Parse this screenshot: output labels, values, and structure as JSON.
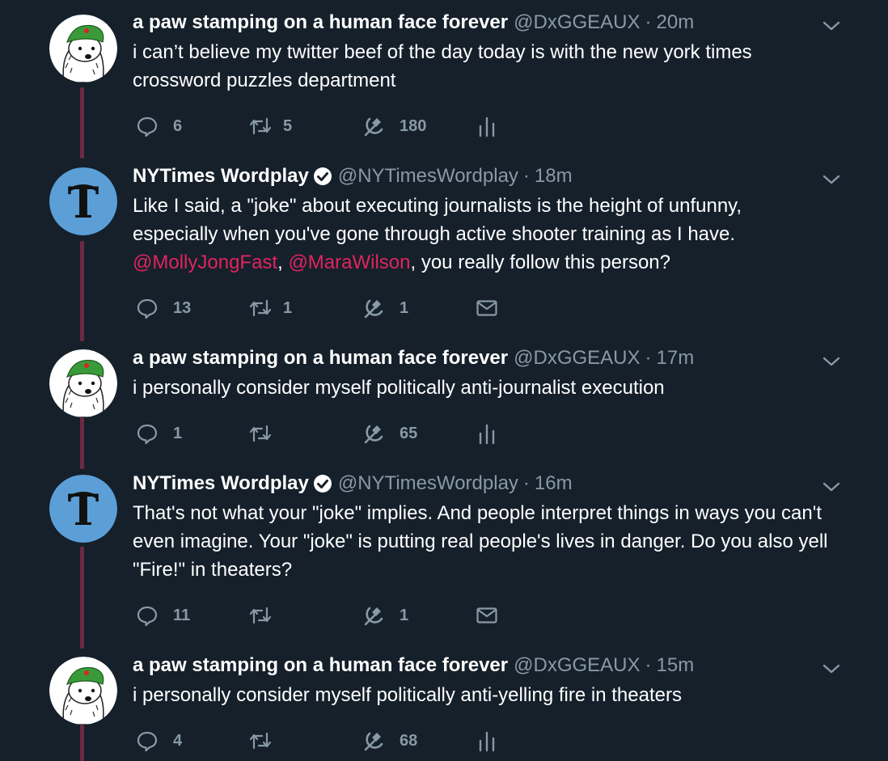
{
  "colors": {
    "background": "#15202b",
    "secondary_text": "#8899a6",
    "mention": "#e0245e",
    "thread_line": "#6b2a44"
  },
  "tweets": [
    {
      "author": "paw",
      "name": "a paw stamping on a human face forever",
      "handle": "@DxGGEAUX",
      "separator": "·",
      "time": "20m",
      "lines": [
        "i can’t believe my twitter beef of the day today is with the new york times",
        "crossword puzzles department"
      ],
      "replies": "6",
      "retweets": "5",
      "likes": "180",
      "last_action_icon": "analytics-icon"
    },
    {
      "author": "nyt",
      "name": "NYTimes Wordplay",
      "handle": "@NYTimesWordplay",
      "separator": "·",
      "time": "18m",
      "lines": [
        "Like I said, a \"joke\" about executing journalists is the height of unfunny,",
        "especially when you've gone through active shooter training as I have."
      ],
      "mention_1": "@MollyJongFast",
      "mention_sep": ",",
      "mention_2": "@MaraWilson",
      "mention_tail": ", you really follow this person?",
      "replies": "13",
      "retweets": "1",
      "likes": "1",
      "last_action_icon": "message-icon"
    },
    {
      "author": "paw",
      "name": "a paw stamping on a human face forever",
      "handle": "@DxGGEAUX",
      "separator": "·",
      "time": "17m",
      "lines": [
        "i personally consider myself politically anti-journalist execution"
      ],
      "replies": "1",
      "retweets": "",
      "likes": "65",
      "last_action_icon": "analytics-icon"
    },
    {
      "author": "nyt",
      "name": "NYTimes Wordplay",
      "handle": "@NYTimesWordplay",
      "separator": "·",
      "time": "16m",
      "lines": [
        "That's not what your \"joke\" implies. And people interpret things in ways you can't",
        "even imagine. Your \"joke\" is putting real people's lives in danger. Do you also yell",
        "\"Fire!\" in theaters?"
      ],
      "replies": "11",
      "retweets": "",
      "likes": "1",
      "last_action_icon": "message-icon"
    },
    {
      "author": "paw",
      "name": "a paw stamping on a human face forever",
      "handle": "@DxGGEAUX",
      "separator": "·",
      "time": "15m",
      "lines": [
        "i personally consider myself politically anti-yelling fire in theaters"
      ],
      "replies": "4",
      "retweets": "",
      "likes": "68",
      "last_action_icon": "analytics-icon"
    }
  ]
}
